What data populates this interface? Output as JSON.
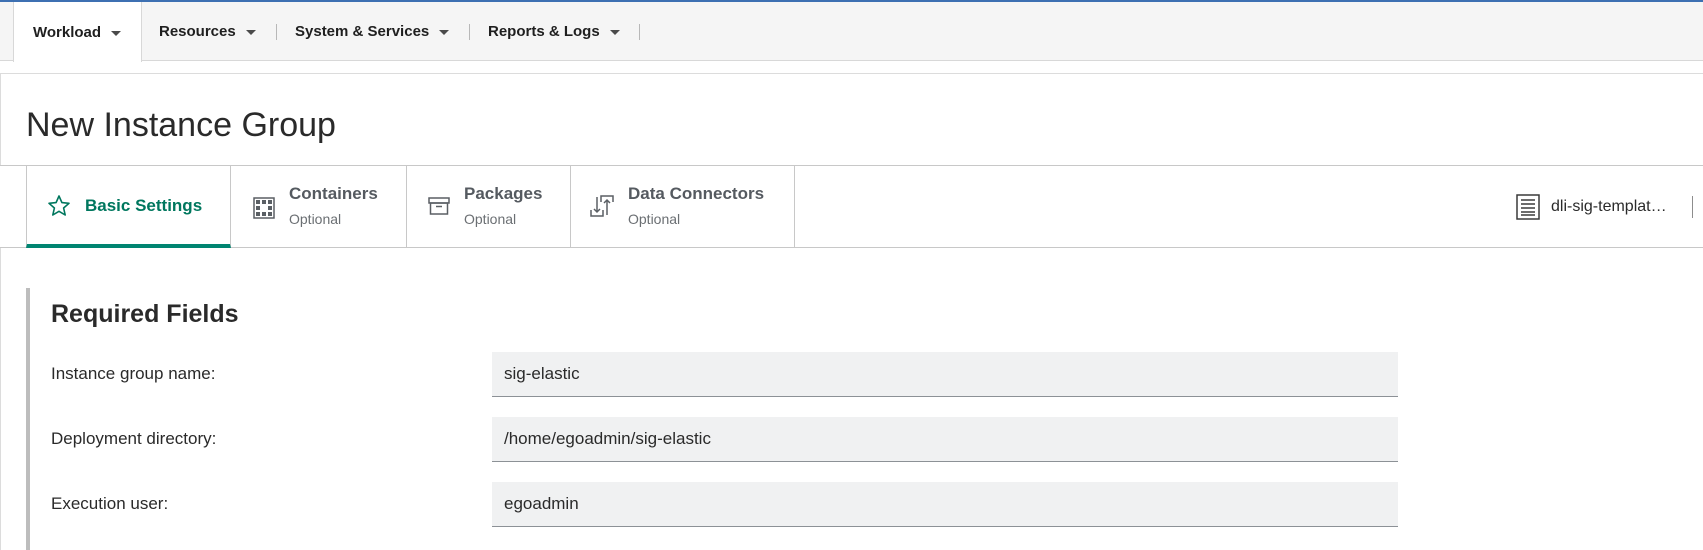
{
  "topnav": {
    "items": [
      {
        "label": "Workload"
      },
      {
        "label": "Resources"
      },
      {
        "label": "System & Services"
      },
      {
        "label": "Reports & Logs"
      }
    ]
  },
  "page": {
    "title": "New Instance Group"
  },
  "tabs": [
    {
      "label": "Basic Settings",
      "sub": "",
      "icon": "star-icon",
      "active": true
    },
    {
      "label": "Containers",
      "sub": "Optional",
      "icon": "containers-grid-icon",
      "active": false
    },
    {
      "label": "Packages",
      "sub": "Optional",
      "icon": "package-box-icon",
      "active": false
    },
    {
      "label": "Data Connectors",
      "sub": "Optional",
      "icon": "data-transfer-icon",
      "active": false
    }
  ],
  "template": {
    "label": "dli-sig-templat…",
    "icon": "document-icon"
  },
  "required": {
    "title": "Required Fields",
    "fields": [
      {
        "label": "Instance group name:",
        "value": "sig-elastic"
      },
      {
        "label": "Deployment directory:",
        "value": "/home/egoadmin/sig-elastic"
      },
      {
        "label": "Execution user:",
        "value": "egoadmin"
      }
    ]
  },
  "colors": {
    "accent_green": "#008571",
    "top_border_blue": "#3d70b2",
    "input_bg": "#f0f1f2"
  }
}
